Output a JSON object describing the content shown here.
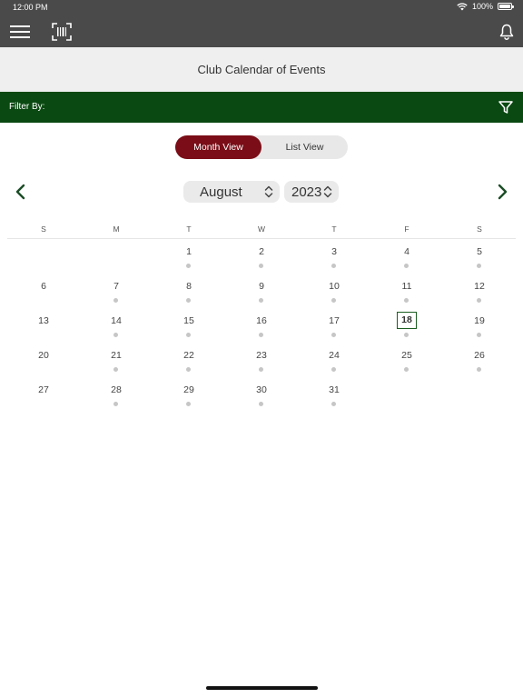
{
  "status_bar": {
    "time": "12:00 PM",
    "battery": "100%",
    "battery_level": 1.0
  },
  "nav": {
    "menu_icon": "hamburger-icon",
    "scan_icon": "barcode-scan-icon",
    "notify_icon": "bell-icon"
  },
  "page": {
    "title": "Club Calendar of Events"
  },
  "filter": {
    "label": "Filter By:",
    "icon": "filter-icon"
  },
  "view_toggle": {
    "month_label": "Month View",
    "list_label": "List View",
    "selected": "Month View"
  },
  "calendar": {
    "month": "August",
    "year": "2023",
    "weekdays": [
      "S",
      "M",
      "T",
      "W",
      "T",
      "F",
      "S"
    ],
    "today": "18",
    "weeks": [
      [
        {
          "d": ""
        },
        {
          "d": ""
        },
        {
          "d": "1",
          "dot": true
        },
        {
          "d": "2",
          "dot": true
        },
        {
          "d": "3",
          "dot": true
        },
        {
          "d": "4",
          "dot": true
        },
        {
          "d": "5",
          "dot": true
        }
      ],
      [
        {
          "d": "6"
        },
        {
          "d": "7",
          "dot": true
        },
        {
          "d": "8",
          "dot": true
        },
        {
          "d": "9",
          "dot": true
        },
        {
          "d": "10",
          "dot": true
        },
        {
          "d": "11",
          "dot": true
        },
        {
          "d": "12",
          "dot": true
        }
      ],
      [
        {
          "d": "13"
        },
        {
          "d": "14",
          "dot": true
        },
        {
          "d": "15",
          "dot": true
        },
        {
          "d": "16",
          "dot": true
        },
        {
          "d": "17",
          "dot": true
        },
        {
          "d": "18",
          "dot": true,
          "today": true
        },
        {
          "d": "19",
          "dot": true
        }
      ],
      [
        {
          "d": "20"
        },
        {
          "d": "21",
          "dot": true
        },
        {
          "d": "22",
          "dot": true
        },
        {
          "d": "23",
          "dot": true
        },
        {
          "d": "24",
          "dot": true
        },
        {
          "d": "25",
          "dot": true
        },
        {
          "d": "26",
          "dot": true
        }
      ],
      [
        {
          "d": "27"
        },
        {
          "d": "28",
          "dot": true
        },
        {
          "d": "29",
          "dot": true
        },
        {
          "d": "30",
          "dot": true
        },
        {
          "d": "31",
          "dot": true
        },
        {
          "d": ""
        },
        {
          "d": ""
        }
      ]
    ]
  },
  "colors": {
    "header_bg": "#4a4a4a",
    "filter_bg": "#0a4a12",
    "accent": "#7a0d17",
    "today_border": "#1b5e20"
  }
}
